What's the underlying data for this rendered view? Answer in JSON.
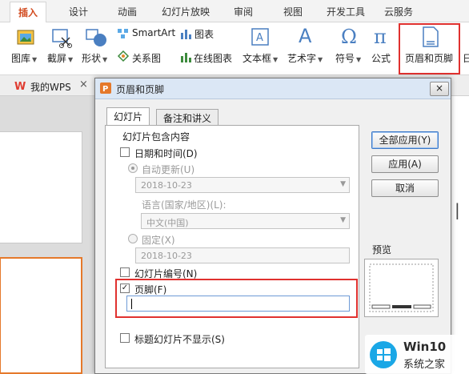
{
  "ribbon": {
    "tabs": [
      "插入",
      "设计",
      "动画",
      "幻灯片放映",
      "审阅",
      "视图",
      "开发工具",
      "云服务"
    ],
    "active_tab": "插入",
    "groups": {
      "picture_lib": "图库",
      "screenshot": "截屏",
      "shapes": "形状",
      "smartart": "SmartArt",
      "chart": "图表",
      "relation": "关系图",
      "online_chart": "在线图表",
      "textbox": "文本框",
      "wordart": "艺术字",
      "symbol": "符号",
      "formula": "公式",
      "header_footer": "页眉和页脚",
      "extra": "日"
    }
  },
  "doc_tabs": {
    "my_wps": "我的WPS"
  },
  "dialog": {
    "title": "页眉和页脚",
    "close": "×",
    "tabs": [
      "幻灯片",
      "备注和讲义"
    ],
    "section_title": "幻灯片包含内容",
    "datetime": {
      "label": "日期和时间(D)",
      "checked": false
    },
    "auto_update": {
      "label": "自动更新(U)"
    },
    "auto_date": "2018-10-23",
    "language_label": "语言(国家/地区)(L):",
    "language_value": "中文(中国)",
    "fixed": {
      "label": "固定(X)"
    },
    "fixed_date": "2018-10-23",
    "slide_number": {
      "label": "幻灯片编号(N)",
      "checked": false
    },
    "footer": {
      "label": "页脚(F)",
      "checked": true,
      "check_glyph": "✓",
      "value": ""
    },
    "hide_on_title": {
      "label": "标题幻灯片不显示(S)",
      "checked": false
    },
    "buttons": {
      "apply_all": "全部应用(Y)",
      "apply": "应用(A)",
      "cancel": "取消"
    },
    "preview_label": "预览"
  },
  "watermark": {
    "brand": "Win10",
    "sub": "系统之家"
  },
  "colors": {
    "accent": "#d24b1f",
    "highlight": "#e0312f",
    "wps_red": "#e03c31",
    "win_blue": "#1aa7e6"
  }
}
